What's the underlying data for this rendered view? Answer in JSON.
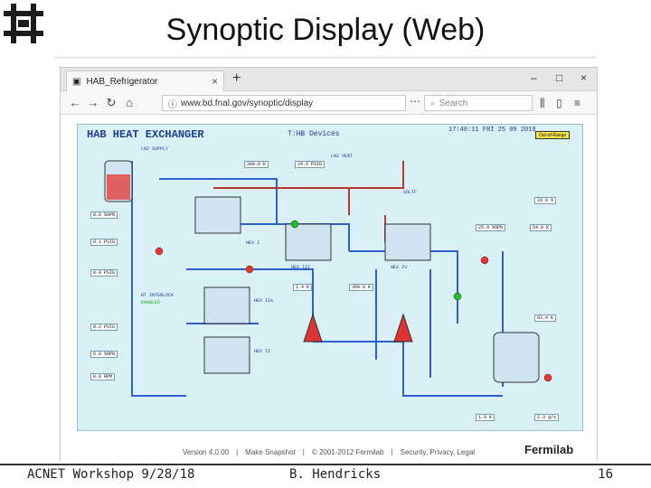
{
  "slide": {
    "title": "Synoptic Display (Web)",
    "footer_left": "ACNET Workshop 9/28/18",
    "footer_middle": "B. Hendricks",
    "page_number": "16"
  },
  "browser": {
    "tab_title": "HAB_Refrigerator",
    "url": "www.bd.fnal.gov/synoptic/display",
    "search_placeholder": "Search",
    "footer_version": "Version 4.0.00",
    "footer_snapshot": "Make Snapshot",
    "footer_copyright": "© 2001-2012 Fermilab",
    "footer_links": "Security, Privacy, Legal",
    "fermilab_logo_text": "Fermilab"
  },
  "synoptic": {
    "title": "HAB HEAT EXCHANGER",
    "subtitle": "T:HB Devices",
    "clock": "17:40:11 FRI 25 09 2018",
    "out_of_range": "Out-of-Range",
    "labels": {
      "ln2_supply": "LN2 SUPPLY",
      "ln2_vent": "LN2 VENT",
      "hex_ii": "HEX II",
      "hex_iii": "HEX III",
      "hex_iv": "HEX IV",
      "hex_i": "HEX I",
      "hex_iia": "HEX IIA",
      "interlock": "HT INTERLOCK",
      "enabled": "ENABLED",
      "soltf": "SOLTF"
    },
    "values": {
      "v1": "8.8 %OPN",
      "v2": "0.1 PSIG",
      "v3": "300.0 K",
      "v4": "24.5 PSIG",
      "v5": "8.0 PSIG",
      "v6": "0.2 PSIG",
      "v7": "1.4 K",
      "v8": "300.0 K",
      "v9": "6.0 %OPN",
      "v10": "0.0 RPM",
      "v11": "25.0 %OPN",
      "v12": "54.0 K",
      "v13": "20.0 %",
      "v14": "83.4 K",
      "v15": "2.3 g/s",
      "v16": "1.9 K"
    }
  },
  "colors": {
    "accent": "#1d3f8a",
    "panel": "#d9f0f6",
    "pipe_blue": "#2f5fd0",
    "pipe_red": "#c0392b"
  },
  "icons": {
    "logo": "fermilab-logo-icon",
    "tab": "document-icon",
    "back": "back-arrow-icon",
    "forward": "forward-arrow-icon",
    "reload": "reload-icon",
    "home": "home-icon",
    "info": "info-icon",
    "search": "search-icon"
  }
}
